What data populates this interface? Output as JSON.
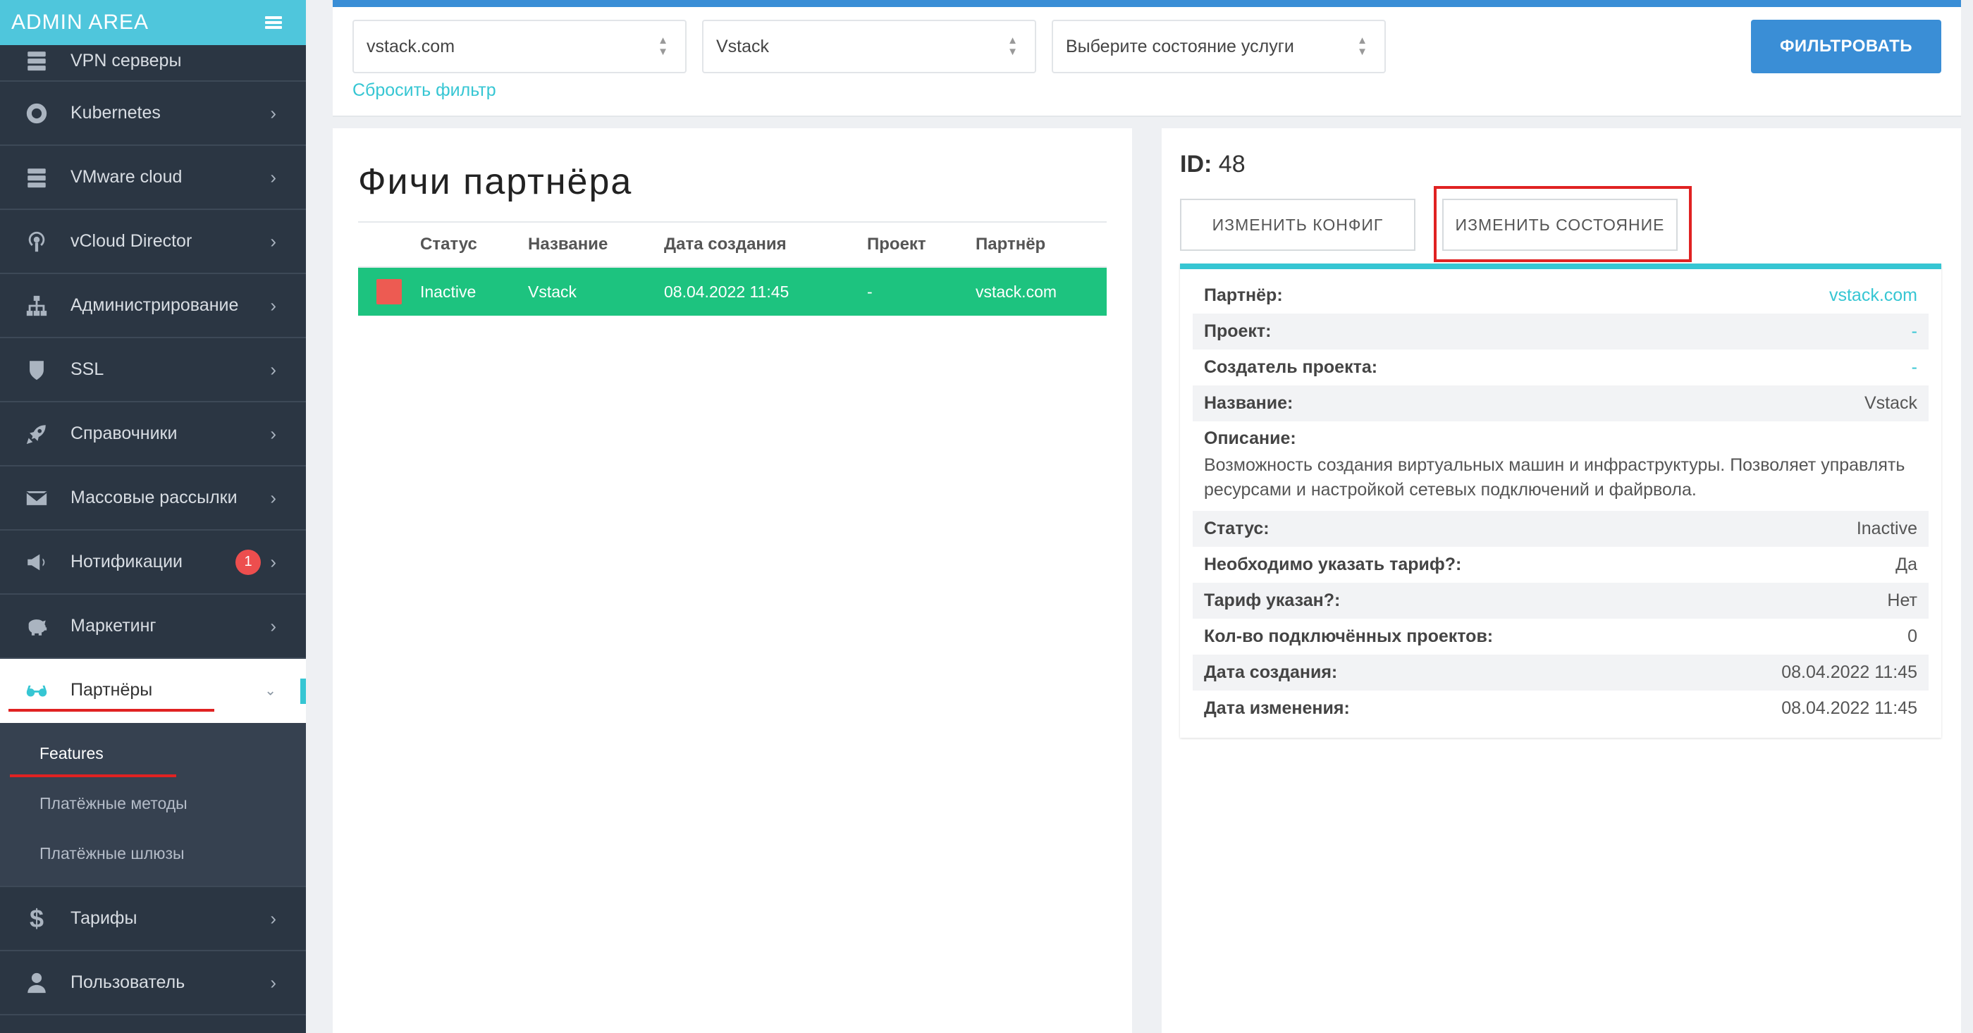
{
  "sidebar": {
    "brand": "ADMIN AREA",
    "items": [
      {
        "label": "VPN серверы",
        "icon": "server-icon"
      },
      {
        "label": "Kubernetes",
        "icon": "lifebuoy-icon"
      },
      {
        "label": "VMware cloud",
        "icon": "server-icon"
      },
      {
        "label": "vCloud Director",
        "icon": "podcast-icon"
      },
      {
        "label": "Администрирование",
        "icon": "sitemap-icon"
      },
      {
        "label": "SSL",
        "icon": "shield-icon"
      },
      {
        "label": "Справочники",
        "icon": "rocket-icon"
      },
      {
        "label": "Массовые рассылки",
        "icon": "envelope-icon"
      },
      {
        "label": "Нотификации",
        "icon": "megaphone-icon",
        "badge": "1"
      },
      {
        "label": "Маркетинг",
        "icon": "piggy-bank-icon"
      },
      {
        "label": "Партнёры",
        "icon": "glasses-icon"
      },
      {
        "label": "Тарифы",
        "icon": "dollar-icon"
      },
      {
        "label": "Пользователь",
        "icon": "user-icon"
      }
    ],
    "submenu": [
      {
        "label": "Features"
      },
      {
        "label": "Платёжные методы"
      },
      {
        "label": "Платёжные шлюзы"
      }
    ]
  },
  "filters": {
    "partner": "vstack.com",
    "project": "Vstack",
    "state_placeholder": "Выберите состояние услуги",
    "reset": "Сбросить фильтр",
    "submit": "ФИЛЬТРОВАТЬ"
  },
  "features": {
    "title": "Фичи партнёра",
    "columns": [
      "Статус",
      "Название",
      "Дата создания",
      "Проект",
      "Партнёр"
    ],
    "rows": [
      {
        "status": "Inactive",
        "name": "Vstack",
        "created": "08.04.2022 11:45",
        "project": "-",
        "partner": "vstack.com"
      }
    ]
  },
  "detail": {
    "id_label": "ID:",
    "id_value": "48",
    "btn_config": "ИЗМЕНИТЬ КОНФИГ",
    "btn_state": "ИЗМЕНИТЬ СОСТОЯНИЕ",
    "fields": {
      "partner": {
        "k": "Партнёр:",
        "v": "vstack.com"
      },
      "project": {
        "k": "Проект:",
        "v": "-"
      },
      "creator": {
        "k": "Создатель проекта:",
        "v": "-"
      },
      "name": {
        "k": "Название:",
        "v": "Vstack"
      },
      "description": {
        "k": "Описание:",
        "v": "Возможность создания виртуальных машин и инфраструктуры. Позволяет управлять ресурсами и настройкой сетевых подключений и файрвола."
      },
      "status": {
        "k": "Статус:",
        "v": "Inactive"
      },
      "tariff_required": {
        "k": "Необходимо указать тариф?:",
        "v": "Да"
      },
      "tariff_set": {
        "k": "Тариф указан?:",
        "v": "Нет"
      },
      "projects_count": {
        "k": "Кол-во подключённых проектов:",
        "v": "0"
      },
      "created": {
        "k": "Дата создания:",
        "v": "08.04.2022 11:45"
      },
      "updated": {
        "k": "Дата изменения:",
        "v": "08.04.2022 11:45"
      }
    }
  },
  "colors": {
    "accent": "#36c6d3",
    "primary": "#3a8ed6",
    "row_success": "#1dc37f",
    "status_inactive": "#ed5b52",
    "highlight": "#e02222",
    "sidebar_bg": "#2b3643"
  }
}
